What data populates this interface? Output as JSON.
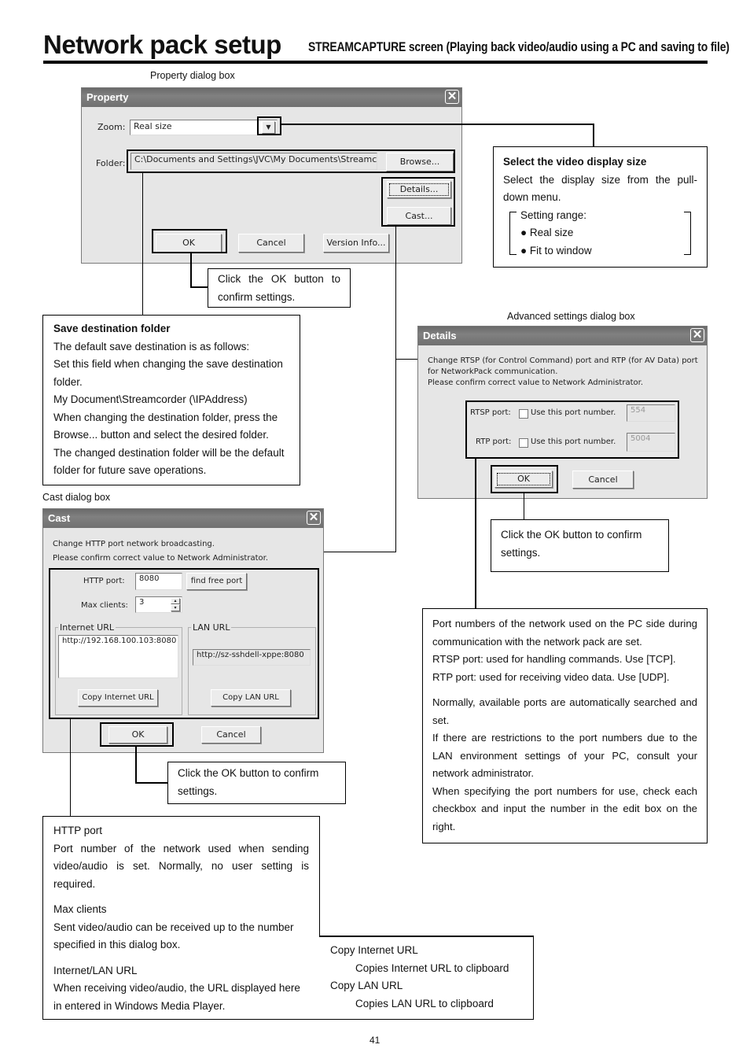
{
  "header": {
    "title": "Network pack setup",
    "subtitle": "STREAMCAPTURE screen (Playing back video/audio using a PC and saving to file)"
  },
  "property_dialog": {
    "caption": "Property dialog box",
    "title": "Property",
    "zoom_label": "Zoom:",
    "zoom_value": "Real size",
    "folder_label": "Folder:",
    "folder_value": "C:\\Documents and Settings\\JVC\\My Documents\\Streamcc",
    "browse_label": "Browse...",
    "details_label": "Details...",
    "cast_label": "Cast...",
    "ok_label": "OK",
    "cancel_label": "Cancel",
    "version_label": "Version Info..."
  },
  "details_dialog": {
    "caption": "Advanced settings dialog box",
    "title": "Details",
    "message_lines": [
      "Change RTSP (for Control Command) port and RTP (for AV Data) port",
      "for NetworkPack communication.",
      "Please confirm correct value to Network Administrator."
    ],
    "rtsp_label": "RTSP port:",
    "rtp_label": "RTP port:",
    "use_port_label": "Use this port number.",
    "rtsp_value": "554",
    "rtp_value": "5004",
    "ok_label": "OK",
    "cancel_label": "Cancel"
  },
  "cast_dialog": {
    "caption": "Cast dialog box",
    "title": "Cast",
    "message_lines": [
      "Change HTTP port network broadcasting.",
      "Please confirm correct value to Network Administrator."
    ],
    "http_port_label": "HTTP port:",
    "http_port_value": "8080",
    "find_free_port_label": "find free port",
    "max_clients_label": "Max clients:",
    "max_clients_value": "3",
    "internet_url_group": "Internet URL",
    "internet_url_value": "http://192.168.100.103:8080",
    "lan_url_group": "LAN URL",
    "lan_url_value": "http://sz-sshdell-xppe:8080",
    "copy_internet_label": "Copy Internet URL",
    "copy_lan_label": "Copy LAN URL",
    "ok_label": "OK",
    "cancel_label": "Cancel"
  },
  "callouts": {
    "video_size": {
      "heading": "Select the video display size",
      "body": "Select the display size from the pull-down menu.",
      "range_label": "Setting range:",
      "options": [
        "● Real size",
        "● Fit to window"
      ]
    },
    "property_ok": "Click the OK button to confirm settings.",
    "save_folder": {
      "heading": "Save destination folder",
      "lines": [
        "The default save destination is as follows:",
        "Set this field when changing the save destination folder.",
        "My Document\\Streamcorder (\\IPAddress)",
        "When changing the destination folder, press the Browse... button and select the desired folder.",
        "The changed destination folder will be the default folder for future save operations."
      ]
    },
    "details_ok": "Click the OK button to confirm settings.",
    "ports": {
      "para1": "Port numbers of the network used on the PC side during communication with the network pack are set.",
      "para1b": "RTSP port: used for handling commands. Use [TCP].",
      "para1c": "RTP port: used for receiving video data. Use [UDP].",
      "para2": "Normally, available ports are automatically searched and set.",
      "para3": "If there are restrictions to the port numbers due to the LAN environment settings of your PC, consult your network administrator.",
      "para4": "When specifying the port numbers for use, check each checkbox and input the number in the edit box on the right."
    },
    "cast_ok": "Click the OK button to confirm settings.",
    "cast_info": {
      "http_heading": "HTTP port",
      "http_body": "Port number of the network used when sending video/audio is set. Normally, no user setting is required.",
      "max_heading": "Max clients",
      "max_body": "Sent video/audio can be received up to the number specified in this dialog box.",
      "url_heading": "Internet/LAN URL",
      "url_body": "When receiving video/audio, the URL displayed here in entered in Windows Media Player.",
      "copy_internet_heading": "Copy Internet URL",
      "copy_internet_body": "Copies Internet URL to clipboard",
      "copy_lan_heading": "Copy LAN URL",
      "copy_lan_body": "Copies LAN URL to clipboard"
    }
  },
  "page_number": "41"
}
